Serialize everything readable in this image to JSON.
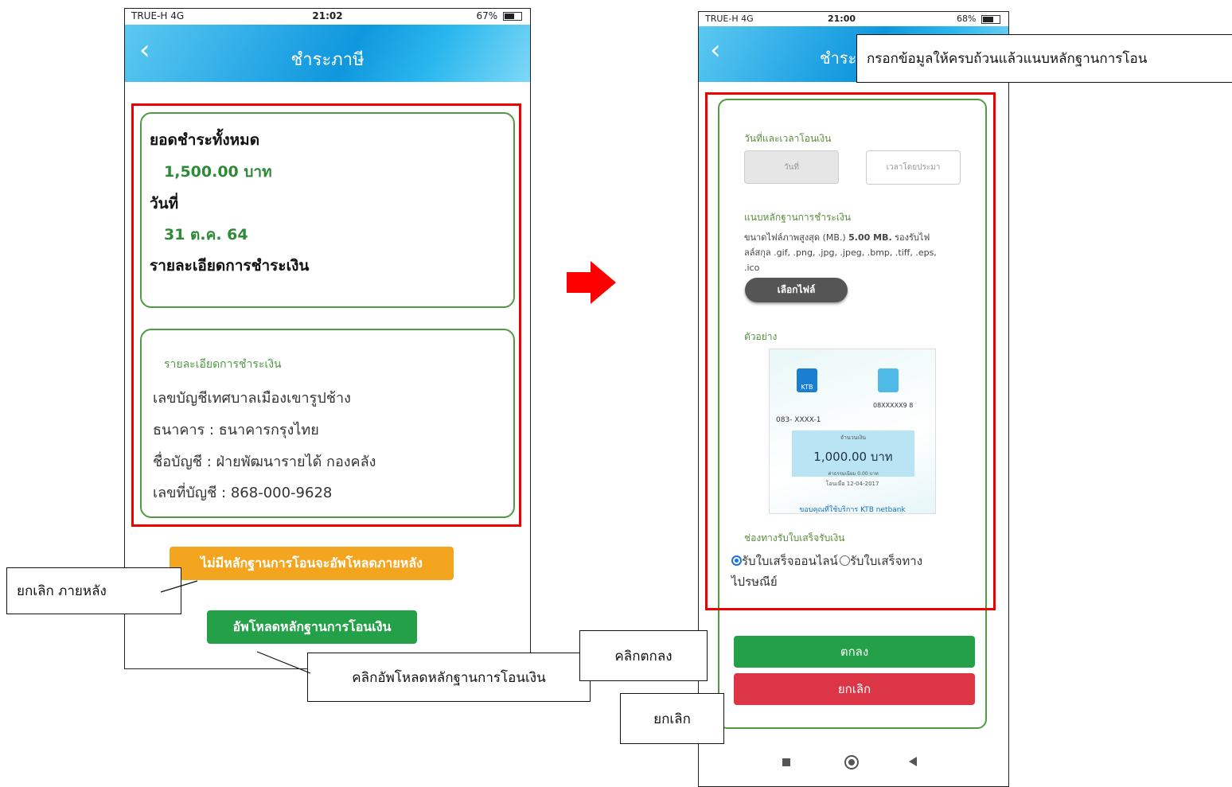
{
  "left_phone": {
    "status": {
      "carrier": "TRUE-H  4G",
      "time": "21:02",
      "battery": "67%"
    },
    "header": {
      "title": "ชำระภาษี",
      "back_icon": "chevron-left-icon"
    },
    "summary": {
      "total_label": "ยอดชำระทั้งหมด",
      "total_value": "1,500.00 บาท",
      "date_label": "วันที่",
      "date_value": "31 ต.ค. 64",
      "details_label": "รายละเอียดการชำระเงิน"
    },
    "bank_details": {
      "heading": "รายละเอียดการชำระเงิน",
      "account_owner": "เลขบัญชีเทศบาลเมืองเขารูปช้าง",
      "bank": "ธนาคาร : ธนาคารกรุงไทย",
      "account_name": "ชื่อบัญชี : ฝ่ายพัฒนารายได้ กองคลัง",
      "account_number": "เลขที่บัญชี : 868-000-9628"
    },
    "buttons": {
      "upload_later": "ไม่มีหลักฐานการโอนจะอัพโหลดภายหลัง",
      "upload_proof": "อัพโหลดหลักฐานการโอนเงิน"
    }
  },
  "callouts": {
    "cancel_later": "ยกเลิก ภายหลัง",
    "click_upload": "คลิกอัพโหลดหลักฐานการโอนเงิน",
    "fill_form": "กรอกข้อมูลให้ครบถ้วนแล้วแนบหลักฐานการโอน",
    "click_ok": "คลิกตกลง",
    "cancel": "ยกเลิก"
  },
  "right_phone": {
    "status": {
      "carrier": "TRUE-H  4G",
      "time": "21:00",
      "battery": "68%"
    },
    "header": {
      "title_partial": "ชำระ"
    },
    "form": {
      "datetime_label": "วันที่และเวลาโอนเงิน",
      "date_placeholder": "วันที่",
      "time_placeholder": "เวลาโดยประมา",
      "attach_label": "แนบหลักฐานการชำระเงิน",
      "file_note_1": "ขนาดไฟล์ภาพสูงสุด (MB.) ",
      "file_note_bold": "5.00 MB.",
      "file_note_2": " รองรับไฟ",
      "file_note_3": "ลล์สกุล .gif, .png, .jpg, .jpeg, .bmp, .tiff, .eps,",
      "file_note_4": ".ico",
      "choose_file": "เลือกไฟล์",
      "example_label": "ตัวอย่าง",
      "receipt_channel_label": "ช่องทางรับใบเสร็จรับเงิน",
      "option_online": "รับใบเสร็จออนไลน์",
      "option_post_1": "รับใบเสร็จทาง",
      "option_post_2": "ไปรษณีย์",
      "selected_option": "online",
      "ok_button": "ตกลง",
      "cancel_button": "ยกเลิก"
    },
    "slip": {
      "bank": "KTB",
      "left_acct": "083-  XXXX-1",
      "right_acct": "08XXXXX9  8",
      "amount_label": "จำนวนเงิน",
      "amount": "1,000.00 บาท",
      "fee": "ค่าธรรมเนียม 0.00 บาท",
      "date": "โอนเมื่อ 12-04-2017",
      "footer": "ขอบคุณที่ใช้บริการ KTB netbank"
    }
  },
  "colors": {
    "red_highlight": "#ee0000",
    "green_border": "#4f9a43",
    "orange_button": "#f3a51f",
    "green_button": "#23a048",
    "red_button": "#dc3545",
    "arrow": "#ff0000"
  }
}
